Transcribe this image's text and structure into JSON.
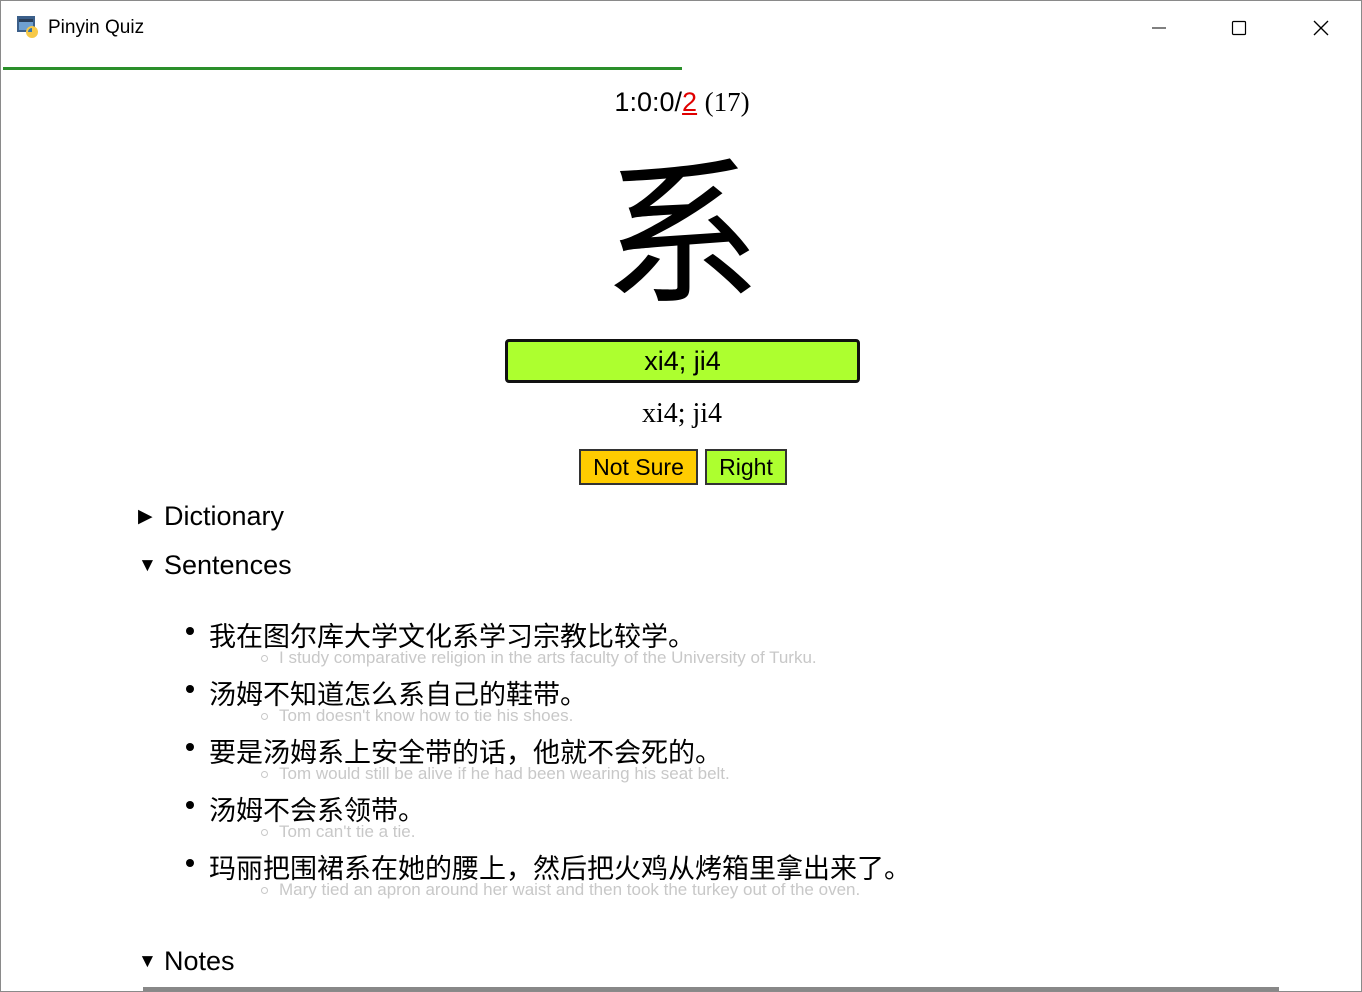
{
  "window": {
    "title": "Pinyin Quiz"
  },
  "progress": {
    "fraction": 0.5
  },
  "score": {
    "right": "1",
    "sep1": ":",
    "unsure": "0",
    "sep2": ":",
    "streak": "0",
    "slash": "/",
    "wrong": "2",
    "remaining": "(17)"
  },
  "quiz": {
    "character": "系",
    "input_value": "xi4; ji4",
    "correct_answer": "xi4; ji4"
  },
  "buttons": {
    "not_sure": "Not Sure",
    "right": "Right"
  },
  "sections": {
    "dictionary": "Dictionary",
    "sentences": "Sentences",
    "notes": "Notes"
  },
  "sentences": [
    {
      "zh": "我在图尔库大学文化系学习宗教比较学。",
      "en": "I study comparative religion in the arts faculty of the University of Turku."
    },
    {
      "zh": "汤姆不知道怎么系自己的鞋带。",
      "en": "Tom doesn't know how to tie his shoes."
    },
    {
      "zh": "要是汤姆系上安全带的话，他就不会死的。",
      "en": "Tom would still be alive if he had been wearing his seat belt."
    },
    {
      "zh": "汤姆不会系领带。",
      "en": "Tom can't tie a tie."
    },
    {
      "zh": "玛丽把围裙系在她的腰上，然后把火鸡从烤箱里拿出来了。",
      "en": "Mary tied an apron around her waist and then took the turkey out of the oven."
    }
  ],
  "colors": {
    "progress": "#2a8f2a",
    "input_bg": "#adff2f",
    "not_sure_bg": "#ffcc00",
    "right_bg": "#adff2f",
    "wrong_count": "#e00000"
  }
}
